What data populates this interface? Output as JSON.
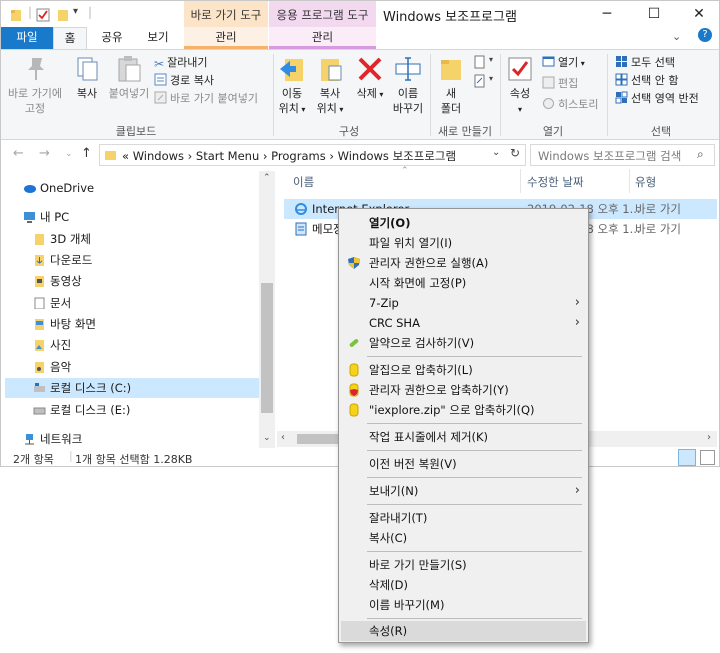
{
  "titlebar": {
    "contextual_tab_shortcut": "바로 가기 도구",
    "contextual_tab_app": "응용 프로그램 도구",
    "title": "Windows 보조프로그램",
    "minimize": "─",
    "maximize": "☐",
    "close": "✕"
  },
  "tabs": {
    "file": "파일",
    "home": "홈",
    "share": "공유",
    "view": "보기",
    "manage_shortcut": "관리",
    "manage_app": "관리"
  },
  "ribbon": {
    "clipboard": {
      "label": "클립보드",
      "pin": [
        "바로 가기에",
        "고정"
      ],
      "copy": "복사",
      "paste": "붙여넣기",
      "cut": "잘라내기",
      "copy_path": "경로 복사",
      "paste_shortcut": "바로 가기 붙여넣기"
    },
    "organize": {
      "label": "구성",
      "move_to": [
        "이동",
        "위치"
      ],
      "copy_to": [
        "복사",
        "위치"
      ],
      "delete": "삭제",
      "rename": [
        "이름",
        "바꾸기"
      ]
    },
    "new": {
      "label": "새로 만들기",
      "new_folder": [
        "새",
        "폴더"
      ]
    },
    "open": {
      "label": "열기",
      "properties": "속성",
      "open": "열기",
      "edit": "편집",
      "history": "히스토리"
    },
    "select": {
      "label": "선택",
      "select_all": "모두 선택",
      "select_none": "선택 안 함",
      "invert": "선택 영역 반전"
    }
  },
  "address": {
    "crumbs": "«  Windows  ›  Start Menu  ›  Programs  ›  Windows 보조프로그램",
    "search_placeholder": "Windows 보조프로그램 검색"
  },
  "navpane": {
    "items": [
      {
        "label": "OneDrive"
      },
      {
        "label": "내 PC"
      },
      {
        "label": "3D 개체"
      },
      {
        "label": "다운로드"
      },
      {
        "label": "동영상"
      },
      {
        "label": "문서"
      },
      {
        "label": "바탕 화면"
      },
      {
        "label": "사진"
      },
      {
        "label": "음악"
      },
      {
        "label": "로컬 디스크 (C:)"
      },
      {
        "label": "로컬 디스크 (E:)"
      },
      {
        "label": "네트워크"
      }
    ]
  },
  "filelist": {
    "columns": {
      "name": "이름",
      "modified": "수정한 날짜",
      "type": "유형"
    },
    "rows": [
      {
        "name": "Internet Explorer",
        "modified": "2019-02-18 오후 1...",
        "type": "바로 가기"
      },
      {
        "name": "메모장",
        "modified": "2019-02-18 오후 1...",
        "type": "바로 가기"
      }
    ]
  },
  "status": {
    "count": "2개 항목",
    "selection": "1개 항목 선택함 1.28KB"
  },
  "context_menu": {
    "open": "열기(O)",
    "open_location": "파일 위치 열기(I)",
    "run_as_admin": "관리자 권한으로 실행(A)",
    "pin_start": "시작 화면에 고정(P)",
    "seven_zip": "7-Zip",
    "crc_sha": "CRC SHA",
    "alyac_scan": "알약으로 검사하기(V)",
    "alzip_compress": "알집으로 압축하기(L)",
    "alzip_admin": "관리자 권한으로 압축하기(Y)",
    "alzip_named": "\"iexplore.zip\" 으로 압축하기(Q)",
    "unpin_taskbar": "작업 표시줄에서 제거(K)",
    "restore_prev": "이전 버전 복원(V)",
    "send_to": "보내기(N)",
    "cut": "잘라내기(T)",
    "copy": "복사(C)",
    "create_shortcut": "바로 가기 만들기(S)",
    "delete": "삭제(D)",
    "rename": "이름 바꾸기(M)",
    "properties": "속성(R)"
  },
  "colors": {
    "accent": "#1979ca",
    "selection": "#cce8ff",
    "menu_bg": "#f0f0f0"
  }
}
